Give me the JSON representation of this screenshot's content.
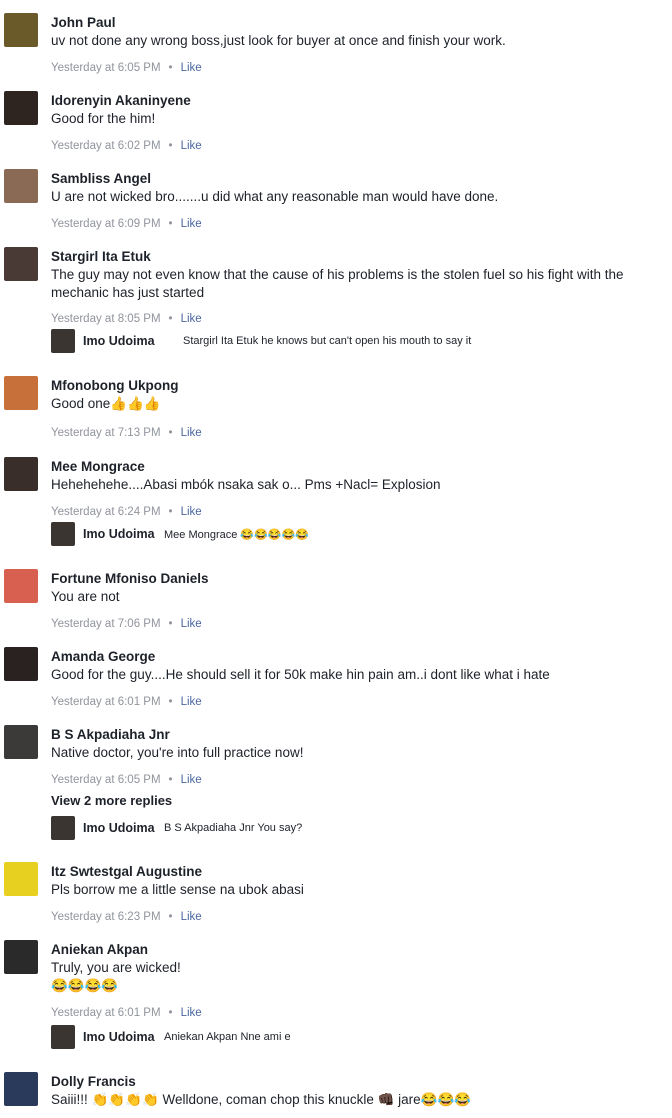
{
  "like_label": "Like",
  "comments": [
    {
      "name": "John Paul",
      "text": "uv not done any wrong boss,just look for buyer at once and finish your work.",
      "time": "Yesterday at 6:05 PM",
      "avatar_color": "#6a5a2a"
    },
    {
      "name": "Idorenyin Akaninyene",
      "text": "Good for the him!",
      "time": "Yesterday at 6:02 PM",
      "avatar_color": "#2e2520"
    },
    {
      "name": "Sambliss Angel",
      "text": "U are not wicked bro.......u did what any reasonable man would have done.",
      "time": "Yesterday at 6:09 PM",
      "avatar_color": "#8a6a55"
    },
    {
      "name": "Stargirl Ita Etuk",
      "text": "The guy may not even know that the cause of his problems is the stolen fuel so his fight with the mechanic has just started",
      "time": "Yesterday at 8:05 PM",
      "avatar_color": "#4a3a35",
      "reply": {
        "name": "Imo Udoima",
        "text": "Stargirl Ita Etuk he knows but can't open his mouth to say it"
      }
    },
    {
      "name": "Mfonobong Ukpong",
      "text": "Good one👍👍👍",
      "time": "Yesterday at 7:13 PM",
      "avatar_color": "#c8703a"
    },
    {
      "name": "Mee Mongrace",
      "text": "Hehehehehe....Abasi mbók nsaka sak o... Pms +Nacl= Explosion",
      "time": "Yesterday at 6:24 PM",
      "avatar_color": "#3a2e2a",
      "reply": {
        "name": "Imo Udoima",
        "text": "Mee Mongrace 😂😂😂😂😂"
      }
    },
    {
      "name": "Fortune Mfoniso Daniels",
      "text": "You are not",
      "time": "Yesterday at 7:06 PM",
      "avatar_color": "#d86050"
    },
    {
      "name": "Amanda George",
      "text": "Good for the guy....He should sell it for 50k make hin pain am..i dont like what i hate",
      "time": "Yesterday at 6:01 PM",
      "avatar_color": "#2a2220"
    },
    {
      "name": "B S Akpadiaha Jnr",
      "text": "Native doctor, you're into full practice now!",
      "time": "Yesterday at 6:05 PM",
      "avatar_color": "#3c3a38",
      "more_replies": "View 2 more replies",
      "reply": {
        "name": "Imo Udoima",
        "text": "B S Akpadiaha Jnr You say?"
      }
    },
    {
      "name": "Itz Swtestgal Augustine",
      "text": "Pls borrow me a little sense na ubok abasi",
      "time": "Yesterday at 6:23 PM",
      "avatar_color": "#e8d020"
    },
    {
      "name": "Aniekan Akpan",
      "text": "Truly, you are wicked!\n😂😂😂😂",
      "time": "Yesterday at 6:01 PM",
      "avatar_color": "#2a2a2a",
      "reply": {
        "name": "Imo Udoima",
        "text": "Aniekan Akpan Nne ami e"
      }
    },
    {
      "name": "Dolly Francis",
      "text": "Saiii!!! 👏👏👏👏 Welldone, coman chop this knuckle 👊🏿 jare😂😂😂",
      "time": "",
      "avatar_color": "#2a3a5a"
    }
  ]
}
